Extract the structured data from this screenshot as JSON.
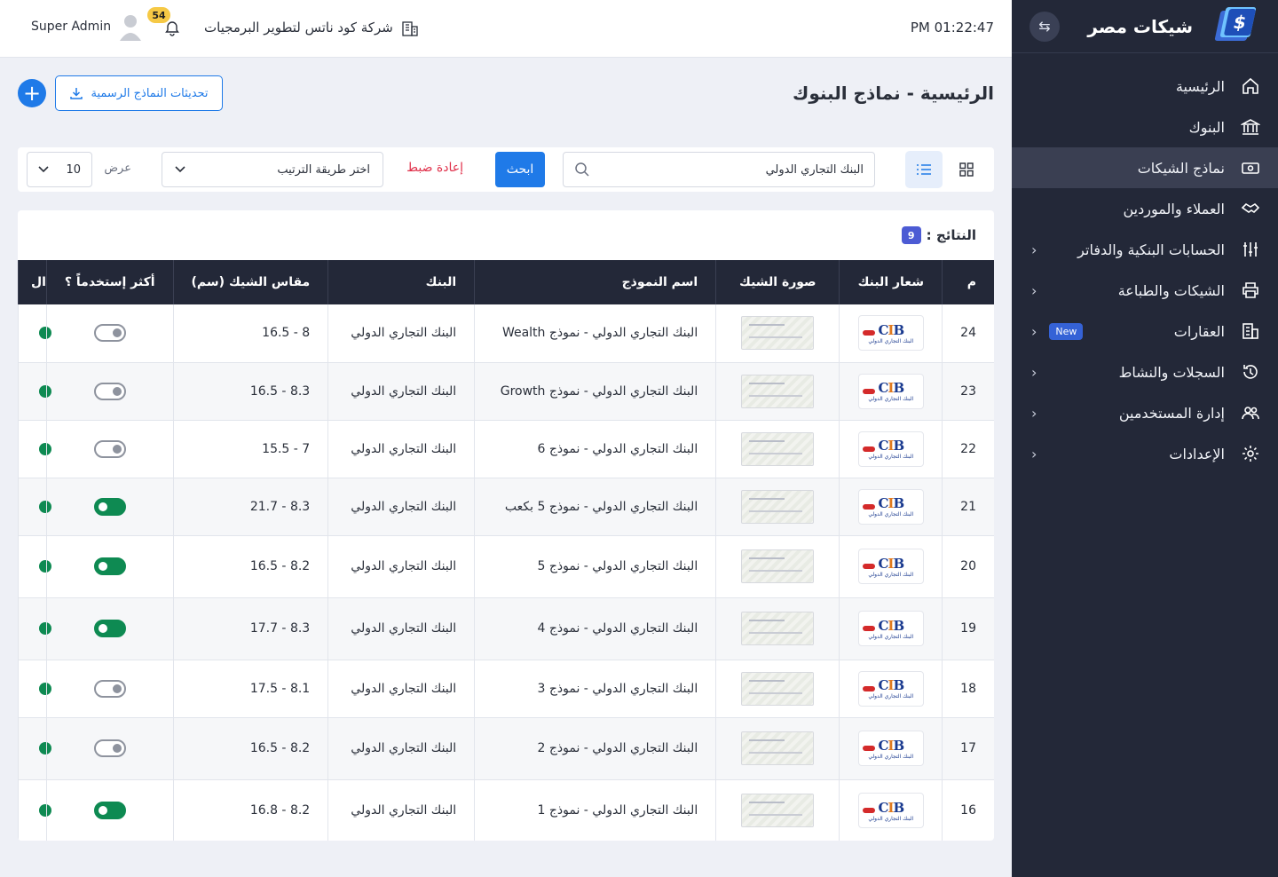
{
  "sidebar": {
    "brand": "شيكات مصر",
    "items": [
      {
        "label": "الرئيسية",
        "icon": "home-icon",
        "active": false,
        "chevron": false
      },
      {
        "label": "البنوك",
        "icon": "bank-icon",
        "active": false,
        "chevron": false
      },
      {
        "label": "نماذج الشيكات",
        "icon": "cheque-icon",
        "active": true,
        "chevron": false
      },
      {
        "label": "العملاء والموردين",
        "icon": "handshake-icon",
        "active": false,
        "chevron": false
      },
      {
        "label": "الحسابات البنكية والدفاتر",
        "icon": "sliders-icon",
        "active": false,
        "chevron": true
      },
      {
        "label": "الشيكات والطباعة",
        "icon": "printer-icon",
        "active": false,
        "chevron": true
      },
      {
        "label": "العقارات",
        "icon": "building-icon",
        "active": false,
        "chevron": true,
        "badge": "New"
      },
      {
        "label": "السجلات والنشاط",
        "icon": "history-icon",
        "active": false,
        "chevron": true
      },
      {
        "label": "إدارة المستخدمين",
        "icon": "users-icon",
        "active": false,
        "chevron": true
      },
      {
        "label": "الإعدادات",
        "icon": "gear-icon",
        "active": false,
        "chevron": true
      }
    ]
  },
  "topbar": {
    "user": "Super Admin",
    "notifications": "54",
    "company": "شركة كود ناتس لتطوير البرمجيات",
    "time": "PM 01:22:47"
  },
  "page": {
    "title": "الرئيسية - نماذج البنوك",
    "updates_button": "تحديثات النماذج الرسمية"
  },
  "filter": {
    "search_value": "البنك التجاري الدولي",
    "search_button": "ابحث",
    "reset": "إعادة ضبط",
    "sort_placeholder": "اختر طريقة الترتيب",
    "show_label": "عرض",
    "per_page": "10"
  },
  "results": {
    "label": "النتائج :",
    "count": "9"
  },
  "table": {
    "headers": [
      "م",
      "شعار البنك",
      "صورة الشيك",
      "اسم النموذج",
      "البنك",
      "مقاس الشيك (سم)",
      "أكثر إستخدماً ؟",
      "ال"
    ],
    "rows": [
      {
        "num": "24",
        "name": "البنك التجاري الدولي - نموذج Wealth",
        "bank": "البنك التجاري الدولي",
        "size": "8 - 16.5",
        "popular": false
      },
      {
        "num": "23",
        "name": "البنك التجاري الدولي - نموذج Growth",
        "bank": "البنك التجاري الدولي",
        "size": "8.3 - 16.5",
        "popular": false
      },
      {
        "num": "22",
        "name": "البنك التجاري الدولي - نموذج 6",
        "bank": "البنك التجاري الدولي",
        "size": "7 - 15.5",
        "popular": false
      },
      {
        "num": "21",
        "name": "البنك التجاري الدولي - نموذج 5 بكعب",
        "bank": "البنك التجاري الدولي",
        "size": "8.3 - 21.7",
        "popular": true
      },
      {
        "num": "20",
        "name": "البنك التجاري الدولي - نموذج 5",
        "bank": "البنك التجاري الدولي",
        "size": "8.2 - 16.5",
        "popular": true
      },
      {
        "num": "19",
        "name": "البنك التجاري الدولي - نموذج 4",
        "bank": "البنك التجاري الدولي",
        "size": "8.3 - 17.7",
        "popular": true
      },
      {
        "num": "18",
        "name": "البنك التجاري الدولي - نموذج 3",
        "bank": "البنك التجاري الدولي",
        "size": "8.1 - 17.5",
        "popular": false
      },
      {
        "num": "17",
        "name": "البنك التجاري الدولي - نموذج 2",
        "bank": "البنك التجاري الدولي",
        "size": "8.2 - 16.5",
        "popular": false
      },
      {
        "num": "16",
        "name": "البنك التجاري الدولي - نموذج 1",
        "bank": "البنك التجاري الدولي",
        "size": "8.2 - 16.8",
        "popular": true
      }
    ]
  },
  "colors": {
    "sidebar_bg": "#232838",
    "primary": "#1f7ae8",
    "toggle_on": "#0e8a52",
    "danger": "#e0314b"
  }
}
